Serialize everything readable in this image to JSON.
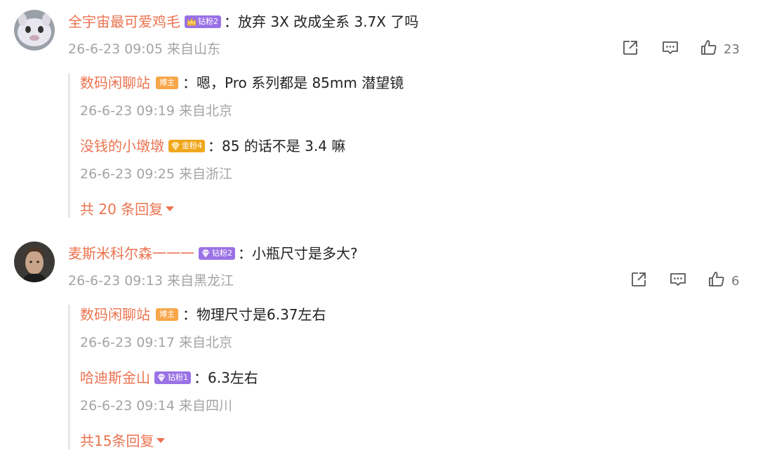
{
  "comments": [
    {
      "user": "全宇宙最可爱鸡毛",
      "badge": "钻粉2",
      "badge_style": "purple",
      "badge_icon": "crown-icon",
      "text": "放弃 3X 改成全系 3.7X 了吗",
      "time": "26-6-23 09:05",
      "location": "来自山东",
      "likes": "23",
      "replies": [
        {
          "user": "数码闲聊站",
          "badge": "博主",
          "badge_style": "host",
          "text": "嗯，Pro 系列都是 85mm 潜望镜",
          "time": "26-6-23 09:19",
          "location": "来自北京"
        },
        {
          "user": "没钱的小墩墩",
          "badge": "金粉4",
          "badge_style": "gold",
          "badge_icon": "gold-gem-icon",
          "text": "85 的话不是 3.4 嘛",
          "time": "26-6-23 09:25",
          "location": "来自浙江"
        }
      ],
      "more_replies": "共 20 条回复"
    },
    {
      "user": "麦斯米科尔森一一一",
      "badge": "钻粉2",
      "badge_style": "purple",
      "badge_icon": "diamond-icon",
      "text": "小瓶尺寸是多大?",
      "time": "26-6-23 09:13",
      "location": "来自黑龙江",
      "likes": "6",
      "replies": [
        {
          "user": "数码闲聊站",
          "badge": "博主",
          "badge_style": "host",
          "text": "物理尺寸是6.37左右",
          "time": "26-6-23 09:17",
          "location": "来自北京"
        },
        {
          "user": "哈迪斯金山",
          "badge": "钻粉1",
          "badge_style": "purple",
          "badge_icon": "diamond-icon",
          "text": "6.3左右",
          "time": "26-6-23 09:14",
          "location": "来自四川"
        }
      ],
      "more_replies": "共15条回复"
    }
  ],
  "colors": {
    "username": "#eb7350",
    "meta": "#a4a4a4",
    "badge_purple": "#9a72e6",
    "badge_gold": "#f0a81f",
    "badge_host": "#f7a64a"
  },
  "icons": {
    "share": "share-icon",
    "comment": "comment-icon",
    "like": "thumbs-up-icon",
    "expand": "caret-down-icon"
  }
}
